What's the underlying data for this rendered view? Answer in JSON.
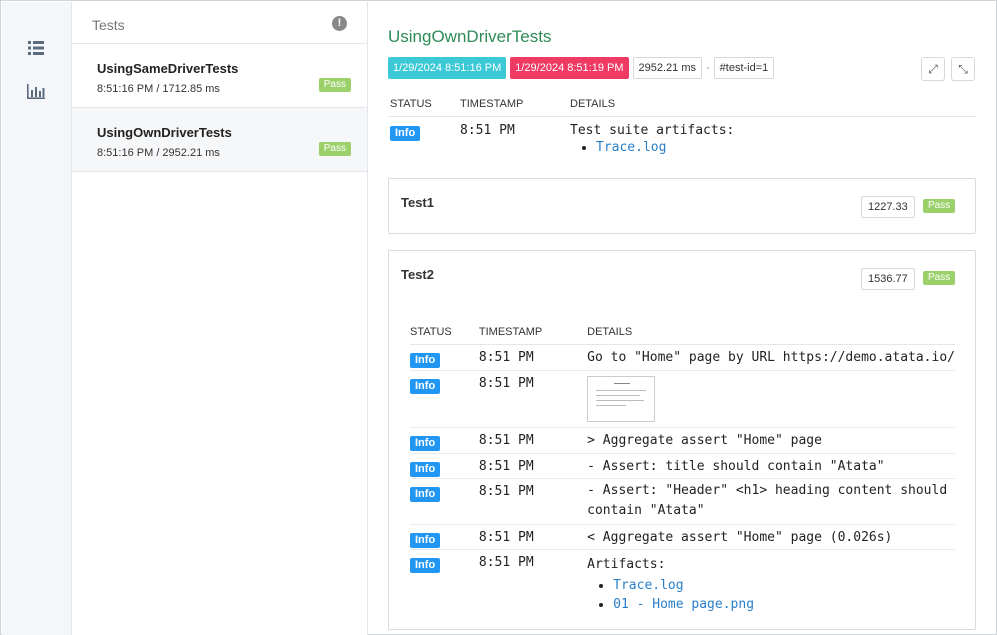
{
  "sidebar": {
    "nav": [
      {
        "icon": "list-icon"
      },
      {
        "icon": "bar-chart-icon"
      }
    ]
  },
  "list": {
    "header": "Tests",
    "items": [
      {
        "name": "UsingSameDriverTests",
        "meta": "8:51:16 PM / 1712.85 ms",
        "status": "Pass"
      },
      {
        "name": "UsingOwnDriverTests",
        "meta": "8:51:16 PM / 2952.21 ms",
        "status": "Pass"
      }
    ]
  },
  "main": {
    "title": "UsingOwnDriverTests",
    "start": "1/29/2024 8:51:16 PM",
    "end": "1/29/2024 8:51:19 PM",
    "duration": "2952.21 ms",
    "sep": "·",
    "test_id": "#test-id=1",
    "cols": {
      "status": "STATUS",
      "timestamp": "TIMESTAMP",
      "details": "DETAILS"
    },
    "suite_log": {
      "status": "Info",
      "time": "8:51 PM",
      "details": "Test suite artifacts:",
      "links": [
        "Trace.log"
      ]
    },
    "tests": [
      {
        "name": "Test1",
        "duration": "1227.33",
        "status": "Pass"
      },
      {
        "name": "Test2",
        "duration": "1536.77",
        "status": "Pass",
        "logs": [
          {
            "status": "Info",
            "time": "8:51 PM",
            "details": "Go to \"Home\" page by URL https://demo.atata.io/"
          },
          {
            "status": "Info",
            "time": "8:51 PM",
            "details": ""
          },
          {
            "status": "Info",
            "time": "8:51 PM",
            "details": "> Aggregate assert \"Home\" page"
          },
          {
            "status": "Info",
            "time": "8:51 PM",
            "details": "- Assert: title should contain \"Atata\""
          },
          {
            "status": "Info",
            "time": "8:51 PM",
            "details": "- Assert: \"Header\" <h1> heading content should contain \"Atata\""
          },
          {
            "status": "Info",
            "time": "8:51 PM",
            "details": "< Aggregate assert \"Home\" page (0.026s)"
          },
          {
            "status": "Info",
            "time": "8:51 PM",
            "details": "Artifacts:",
            "links": [
              "Trace.log",
              "01 - Home page.png"
            ]
          }
        ]
      }
    ]
  },
  "colors": {
    "title": "#2e8b57",
    "start": "#3cc9d6",
    "end": "#ef3b63",
    "pass": "#9bd06b",
    "info": "#2196f3",
    "link": "#2a7fc9"
  }
}
